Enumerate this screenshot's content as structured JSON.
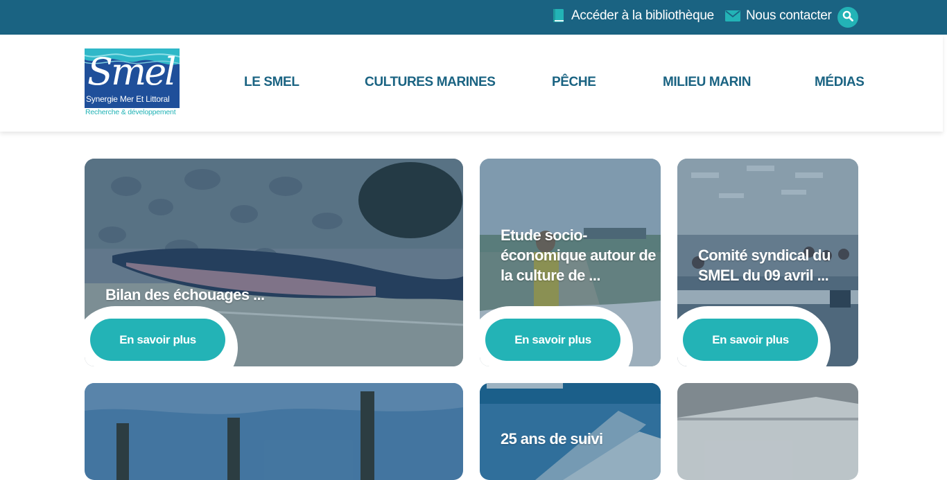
{
  "topbar": {
    "library_label": "Accéder à la bibliothèque",
    "contact_label": "Nous contacter"
  },
  "logo": {
    "wordmark": "Smel",
    "tagline": "Synergie Mer Et Littoral",
    "subline": "Recherche & développement"
  },
  "nav": {
    "items": [
      "LE SMEL",
      "CULTURES MARINES",
      "PÊCHE",
      "MILIEU MARIN",
      "MÉDIAS"
    ]
  },
  "cards": [
    {
      "title": "Bilan des échouages ...",
      "cta": "En savoir plus"
    },
    {
      "title": "Etude socio-économique autour de la culture de ...",
      "cta": "En savoir plus"
    },
    {
      "title": "Comité syndical du SMEL du 09 avril ...",
      "cta": "En savoir plus"
    },
    {
      "title": "",
      "cta": ""
    },
    {
      "title": "25 ans de suivi",
      "cta": ""
    },
    {
      "title": "",
      "cta": ""
    }
  ],
  "colors": {
    "topbar": "#1a6382",
    "accent": "#23b3b6",
    "nav_text": "#1a6382",
    "logo_blue": "#1f4f9a"
  },
  "icons": {
    "library": "book-icon",
    "contact": "envelope-icon",
    "search": "search-icon"
  }
}
